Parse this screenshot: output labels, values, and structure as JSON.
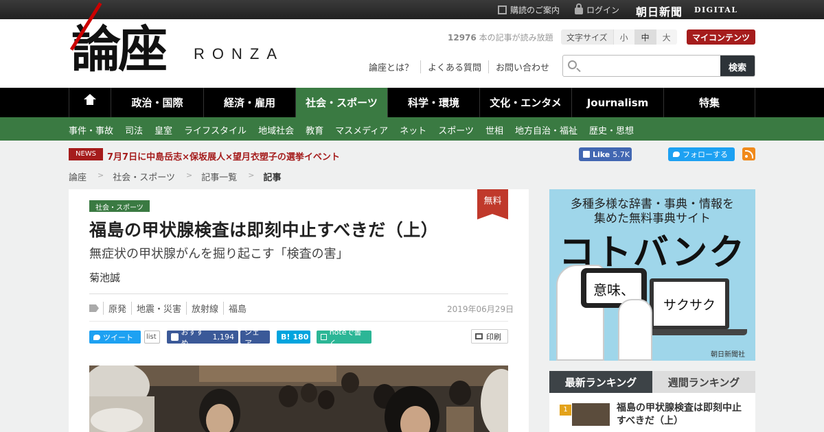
{
  "topbar": {
    "subscribe_label": "購読のご案内",
    "login_label": "ログイン",
    "brand_name": "朝日新聞",
    "brand_sub": "DIGITAL"
  },
  "header": {
    "logo_text": "論座",
    "logo_roman": "RONZA",
    "read_count": "12976",
    "read_count_suffix": " 本の記事が読み放題",
    "font_size_label": "文字サイズ",
    "font_size_options": [
      "小",
      "中",
      "大"
    ],
    "font_size_selected": "中",
    "my_contents_label": "マイコンテンツ",
    "links": [
      "論座とは？",
      "よくある質問",
      "お問い合わせ"
    ],
    "search_placeholder": "",
    "search_button": "検索"
  },
  "main_nav": {
    "items": [
      "政治・国際",
      "経済・雇用",
      "社会・スポーツ",
      "科学・環境",
      "文化・エンタメ",
      "Journalism",
      "特集"
    ],
    "active": "社会・スポーツ"
  },
  "sub_nav": {
    "items": [
      "事件・事故",
      "司法",
      "皇室",
      "ライフスタイル",
      "地域社会",
      "教育",
      "マスメディア",
      "ネット",
      "スポーツ",
      "世相",
      "地方自治・福祉",
      "歴史・思想"
    ]
  },
  "news": {
    "badge": "NEWS",
    "text": "7月7日に中島岳志×保坂展人×望月衣塑子の選挙イベント"
  },
  "social": {
    "fb_like_label": "Like",
    "fb_like_count": "5.7K",
    "tw_follow_label": "フォローする"
  },
  "breadcrumb": [
    "論座",
    "社会・スポーツ",
    "記事一覧",
    "記事"
  ],
  "article": {
    "category": "社会・スポーツ",
    "free_badge": "無料",
    "title": "福島の甲状腺検査は即刻中止すべきだ（上）",
    "subtitle": "無症状の甲状腺がんを掘り起こす「検査の害」",
    "author": "菊池誠",
    "tags": [
      "原発",
      "地震・災害",
      "放射線",
      "福島"
    ],
    "date": "2019年06月29日",
    "share": {
      "tweet_label": "ツイート",
      "list_label": "list",
      "fb_recommend_label": "おすすめ",
      "fb_count": "1,194",
      "fb_share_label": "シェア",
      "hatena_label": "B!",
      "hatena_count": "180",
      "note_label": "noteで書く",
      "print_label": "印刷"
    }
  },
  "sidebar": {
    "ad": {
      "line1": "多種多様な辞書・事典・情報を",
      "line2": "集めた無料事典サイト",
      "brand": "コトバンク",
      "phone_text": "意味、",
      "laptop_text": "サクサク",
      "credit": "朝日新聞社"
    },
    "ranking": {
      "tabs": [
        "最新ランキング",
        "週間ランキング"
      ],
      "active_tab": "最新ランキング",
      "items": [
        {
          "rank": "1",
          "title": "福島の甲状腺検査は即刻中止すべきだ（上）"
        }
      ]
    }
  },
  "colors": {
    "accent_green": "#3a7a42",
    "accent_red": "#a51c1c",
    "nav_black": "#000000"
  }
}
